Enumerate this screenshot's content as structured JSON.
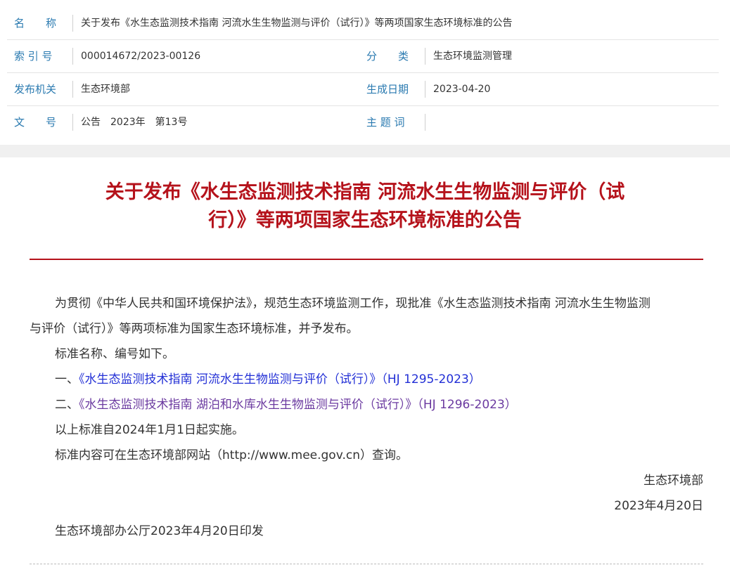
{
  "meta": {
    "name_label": "名　　称",
    "name_value": "关于发布《水生态监测技术指南 河流水生生物监测与评价（试行）》等两项国家生态环境标准的公告",
    "index_label": "索 引 号",
    "index_value": "000014672/2023-00126",
    "category_label": "分　　类",
    "category_value": "生态环境监测管理",
    "issuer_label": "发布机关",
    "issuer_value": "生态环境部",
    "date_label": "生成日期",
    "date_value": "2023-04-20",
    "docno_label": "文　　号",
    "docno_value": "公告　2023年　第13号",
    "subject_label": "主 题 词",
    "subject_value": ""
  },
  "article": {
    "title_line1": "关于发布《水生态监测技术指南 河流水生生物监测与评价（试",
    "title_line2": "行）》等两项国家生态环境标准的公告",
    "p1_line1": "为贯彻《中华人民共和国环境保护法》，规范生态环境监测工作，现批准《水生态监测技术指南 河流水生生物监测",
    "p1_line2": "与评价（试行）》等两项标准为国家生态环境标准，并予发布。",
    "p2": "标准名称、编号如下。",
    "item1_prefix": "一、",
    "item1_link": "《水生态监测技术指南 河流水生生物监测与评价（试行）》（HJ 1295-2023）",
    "item2_prefix": "二、",
    "item2_link": "《水生态监测技术指南 湖泊和水库水生生物监测与评价（试行）》（HJ 1296-2023）",
    "p3": "以上标准自2024年1月1日起实施。",
    "p4": "标准内容可在生态环境部网站（http://www.mee.gov.cn）查询。",
    "signature": "生态环境部",
    "sign_date": "2023年4月20日",
    "footer": "生态环境部办公厅2023年4月20日印发"
  },
  "colors": {
    "title_red": "#b5121b",
    "label_blue": "#2a7ab0",
    "link_blue": "#2330d6",
    "link_purple": "#6b3aa0"
  }
}
